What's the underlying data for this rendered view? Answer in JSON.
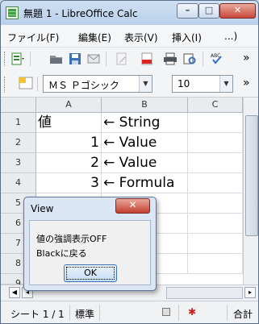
{
  "window": {
    "title": "無題 1 - LibreOffice Calc",
    "min_glyph": "–",
    "max_glyph": "□",
    "close_glyph": "✕"
  },
  "menubar": {
    "items": [
      "ファイル(F)",
      "編集(E)",
      "表示(V)",
      "挿入(I)",
      "...)"
    ]
  },
  "formatbar": {
    "font_name": "ＭＳ Ｐゴシック",
    "font_size": "10"
  },
  "sheet": {
    "columns": [
      "A",
      "B",
      "C"
    ],
    "rows": [
      {
        "num": "1",
        "a": "値",
        "b": "← String"
      },
      {
        "num": "2",
        "a": "1",
        "b": "← Value"
      },
      {
        "num": "3",
        "a": "2",
        "b": "← Value"
      },
      {
        "num": "4",
        "a": "3",
        "b": "← Formula"
      },
      {
        "num": "5",
        "a": "",
        "b": ""
      },
      {
        "num": "6",
        "a": "",
        "b": ""
      },
      {
        "num": "7",
        "a": "",
        "b": ""
      },
      {
        "num": "8",
        "a": "",
        "b": ""
      },
      {
        "num": "9",
        "a": "",
        "b": ""
      }
    ]
  },
  "statusbar": {
    "sheet": "シート 1 / 1",
    "style": "標準",
    "sum": "合計"
  },
  "dialog": {
    "title": "View",
    "close_glyph": "✕",
    "line1": "値の強調表示OFF",
    "line2": "Blackに戻る",
    "ok_label": "OK"
  },
  "colors": {
    "accent": "#3a74c0",
    "close_red": "#c33f2f"
  }
}
